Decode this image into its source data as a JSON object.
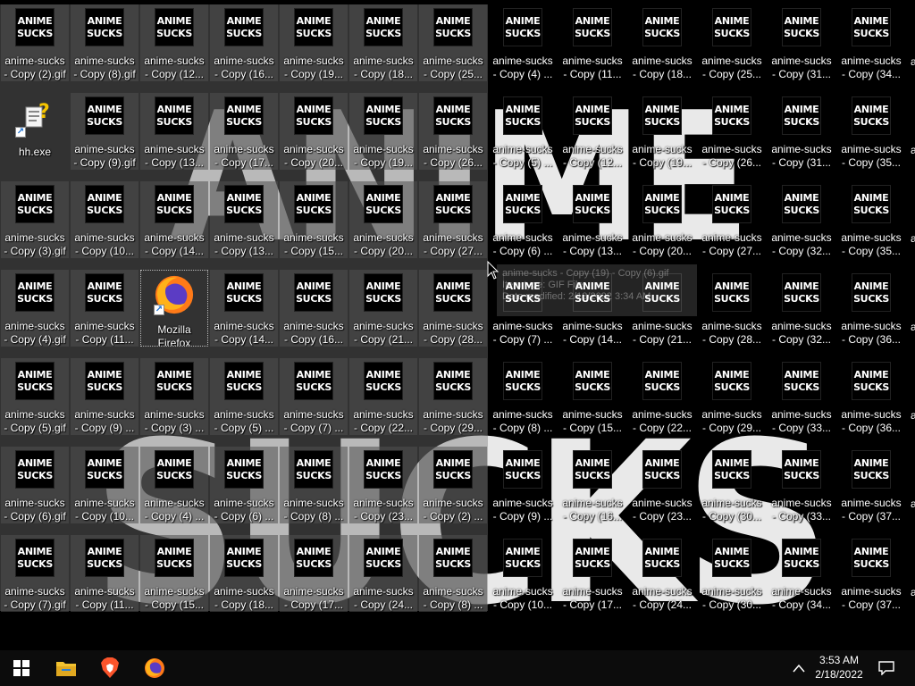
{
  "wallpaper": {
    "line1": "ANIME",
    "line2": "SUCKS"
  },
  "thumbnail": {
    "line1": "ANIME",
    "line2": "SUCKS"
  },
  "desktop_columns": [
    [
      "anime-sucks\n- Copy (2).gif",
      "hh.exe",
      "anime-sucks\n- Copy (3).gif",
      "anime-sucks\n- Copy (4).gif",
      "anime-sucks\n- Copy (5).gif",
      "anime-sucks\n- Copy (6).gif",
      "anime-sucks\n- Copy (7).gif"
    ],
    [
      "anime-sucks\n- Copy (8).gif",
      "anime-sucks\n- Copy (9).gif",
      "anime-sucks\n- Copy (10...",
      "anime-sucks\n- Copy (11...",
      "anime-sucks\n- Copy (9) ...",
      "anime-sucks\n- Copy (10...",
      "anime-sucks\n- Copy (11..."
    ],
    [
      "anime-sucks\n- Copy (12...",
      "anime-sucks\n- Copy (13...",
      "anime-sucks\n- Copy (14...",
      "Mozilla\nFirefox",
      "anime-sucks\n- Copy (3) ...",
      "anime-sucks\n- Copy (4) ...",
      "anime-sucks\n- Copy (15..."
    ],
    [
      "anime-sucks\n- Copy (16...",
      "anime-sucks\n- Copy (17...",
      "anime-sucks\n- Copy (13...",
      "anime-sucks\n- Copy (14...",
      "anime-sucks\n- Copy (5) ...",
      "anime-sucks\n- Copy (6) ...",
      "anime-sucks\n- Copy (18..."
    ],
    [
      "anime-sucks\n- Copy (19...",
      "anime-sucks\n- Copy (20...",
      "anime-sucks\n- Copy (15...",
      "anime-sucks\n- Copy (16...",
      "anime-sucks\n- Copy (7) ...",
      "anime-sucks\n- Copy (8) ...",
      "anime-sucks\n- Copy (17..."
    ],
    [
      "anime-sucks\n- Copy (18...",
      "anime-sucks\n- Copy (19...",
      "anime-sucks\n- Copy (20...",
      "anime-sucks\n- Copy (21...",
      "anime-sucks\n- Copy (22...",
      "anime-sucks\n- Copy (23...",
      "anime-sucks\n- Copy (24..."
    ],
    [
      "anime-sucks\n- Copy (25...",
      "anime-sucks\n- Copy (26...",
      "anime-sucks\n- Copy (27...",
      "anime-sucks\n- Copy (28...",
      "anime-sucks\n- Copy (29...",
      "anime-sucks\n- Copy (2) ...",
      "anime-sucks\n- Copy (8) ..."
    ],
    [
      "anime-sucks\n- Copy (4) ...",
      "anime-sucks\n- Copy (5) ...",
      "anime-sucks\n- Copy (6) ...",
      "anime-sucks\n- Copy (7) ...",
      "anime-sucks\n- Copy (8) ...",
      "anime-sucks\n- Copy (9) ...",
      "anime-sucks\n- Copy (10..."
    ],
    [
      "anime-sucks\n- Copy (11...",
      "anime-sucks\n- Copy (12...",
      "anime-sucks\n- Copy (13...",
      "anime-sucks\n- Copy (14...",
      "anime-sucks\n- Copy (15...",
      "anime-sucks\n- Copy (16...",
      "anime-sucks\n- Copy (17..."
    ],
    [
      "anime-sucks\n- Copy (18...",
      "anime-sucks\n- Copy (19...",
      "anime-sucks\n- Copy (20...",
      "anime-sucks\n- Copy (21...",
      "anime-sucks\n- Copy (22...",
      "anime-sucks\n- Copy (23...",
      "anime-sucks\n- Copy (24..."
    ],
    [
      "anime-sucks\n- Copy (25...",
      "anime-sucks\n- Copy (26...",
      "anime-sucks\n- Copy (27...",
      "anime-sucks\n- Copy (28...",
      "anime-sucks\n- Copy (29...",
      "anime-sucks\n- Copy (30...",
      "anime-sucks\n- Copy (30..."
    ],
    [
      "anime-sucks\n- Copy (31...",
      "anime-sucks\n- Copy (31...",
      "anime-sucks\n- Copy (32...",
      "anime-sucks\n- Copy (32...",
      "anime-sucks\n- Copy (33...",
      "anime-sucks\n- Copy (33...",
      "anime-sucks\n- Copy (34..."
    ],
    [
      "anime-sucks\n- Copy (34...",
      "anime-sucks\n- Copy (35...",
      "anime-sucks\n- Copy (35...",
      "anime-sucks\n- Copy (36...",
      "anime-sucks\n- Copy (36...",
      "anime-sucks\n- Copy (37...",
      "anime-sucks\n- Copy (37..."
    ]
  ],
  "edge_label": "a",
  "tooltip": {
    "line1": "anime-sucks - Copy (19) - Copy (6).gif",
    "line2": "Item type: GIF File",
    "line3": "Date modified: 2/18/2022 3:34 AM"
  },
  "taskbar": {
    "pinned": [
      "start-button",
      "file-explorer",
      "brave-browser",
      "firefox"
    ],
    "time": "3:53 AM",
    "date": "2/18/2022"
  },
  "colors": {
    "taskbar": "#0c0c0c",
    "selection": "#787878",
    "brave": "#fb542b",
    "explorer": "#f2c230"
  },
  "selected_column_count": 7
}
